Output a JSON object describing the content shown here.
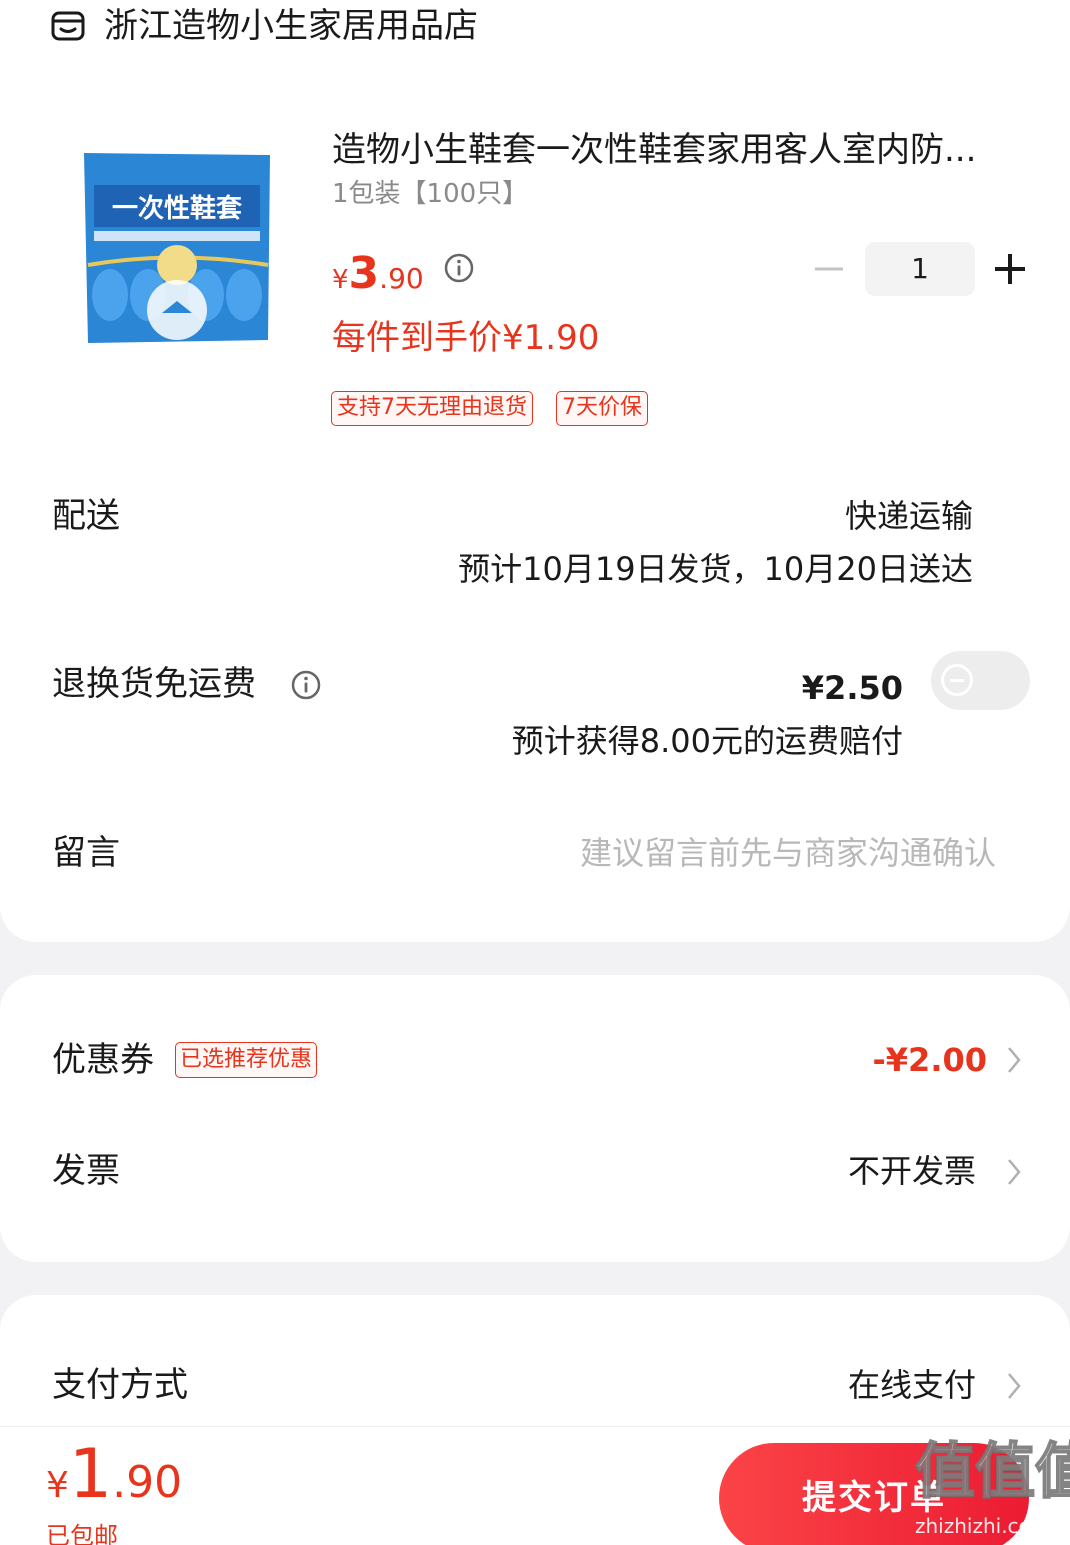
{
  "shop": {
    "name": "浙江造物小生家居用品店",
    "icon": "shop-icon"
  },
  "product": {
    "title": "造物小生鞋套一次性鞋套家用客人室内防...",
    "spec": "1包装【100只】",
    "price_currency": "¥",
    "price_int": "3",
    "price_dec": ".90",
    "quantity": "1",
    "final_price": "每件到手价¥1.90",
    "tags": [
      "支持7天无理由退货",
      "7天价保"
    ],
    "image_text": "一次性鞋套"
  },
  "delivery": {
    "label": "配送",
    "method": "快递运输",
    "estimate": "预计10月19日发货，10月20日送达"
  },
  "return_shipping": {
    "label": "退换货免运费",
    "price": "¥2.50",
    "note": "预计获得8.00元的运费赔付",
    "enabled": false
  },
  "message": {
    "label": "留言",
    "placeholder": "建议留言前先与商家沟通确认"
  },
  "coupon": {
    "label": "优惠券",
    "tag": "已选推荐优惠",
    "value": "-¥2.00"
  },
  "invoice": {
    "label": "发票",
    "value": "不开发票"
  },
  "payment": {
    "label": "支付方式",
    "value": "在线支付"
  },
  "footer": {
    "total_currency": "¥",
    "total_int": "1",
    "total_dec": ".90",
    "shipping_note": "已包邮",
    "submit_label": "提交订单",
    "watermark": "值值值",
    "watermark_url": "zhizhizhi.com"
  },
  "colors": {
    "accent": "#e8341c",
    "button": "#f23a3d",
    "background": "#f2f2f4"
  }
}
